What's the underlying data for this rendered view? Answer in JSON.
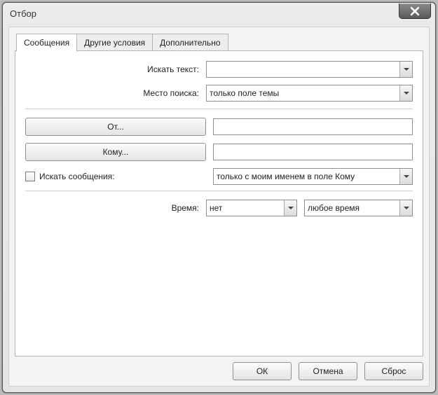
{
  "window": {
    "title": "Отбор"
  },
  "tabs": {
    "t0": "Сообщения",
    "t1": "Другие условия",
    "t2": "Дополнительно"
  },
  "labels": {
    "search_text": "Искать текст:",
    "search_in": "Место поиска:",
    "from_btn": "От...",
    "to_btn": "Кому...",
    "chk_search_msgs": "Искать сообщения:",
    "time": "Время:"
  },
  "fields": {
    "search_text_value": "",
    "search_in_value": "только поле темы",
    "from_value": "",
    "to_value": "",
    "name_scope_value": "только с моим именем в поле Кому",
    "time_when_value": "нет",
    "time_range_value": "любое время"
  },
  "buttons": {
    "ok": "ОК",
    "cancel": "Отмена",
    "reset": "Сброс"
  }
}
